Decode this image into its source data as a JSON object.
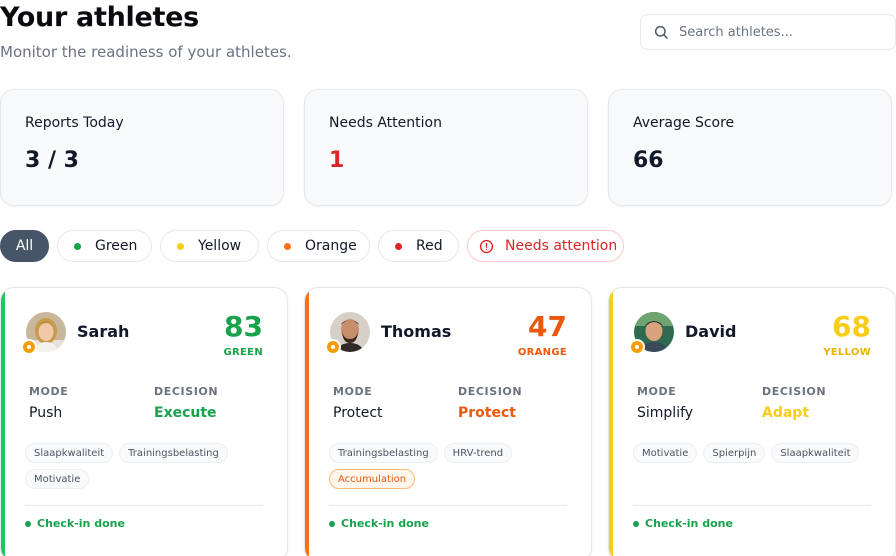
{
  "header": {
    "title": "Your athletes",
    "subtitle": "Monitor the readiness of your athletes."
  },
  "search": {
    "placeholder": "Search athletes...",
    "icon": "search-icon"
  },
  "stats": [
    {
      "label": "Reports Today",
      "value": "3 / 3"
    },
    {
      "label": "Needs Attention",
      "value": "1",
      "color": "#dc2626"
    },
    {
      "label": "Average Score",
      "value": "66"
    }
  ],
  "filters": [
    {
      "label": "All",
      "active": true
    },
    {
      "label": "Green",
      "color": "#16a34a"
    },
    {
      "label": "Yellow",
      "color": "#facc15"
    },
    {
      "label": "Orange",
      "color": "#f97316"
    },
    {
      "label": "Red",
      "color": "#dc2626"
    },
    {
      "label": "Needs attention",
      "icon": "alert-circle-icon",
      "color": "#dc2626"
    }
  ],
  "labels": {
    "mode": "MODE",
    "decision": "DECISION",
    "checkin": "Check-in done"
  },
  "athletes": [
    {
      "name": "Sarah",
      "score": "83",
      "status": "GREEN",
      "status_color": "#16a34a",
      "mode": "Push",
      "decision": "Execute",
      "tags": [
        "Slaapkwaliteit",
        "Trainingsbelasting",
        "Motivatie"
      ]
    },
    {
      "name": "Thomas",
      "score": "47",
      "status": "ORANGE",
      "status_color": "#ea580c",
      "mode": "Protect",
      "decision": "Protect",
      "tags": [
        "Trainingsbelasting",
        "HRV-trend"
      ],
      "warning_tag": "Accumulation"
    },
    {
      "name": "David",
      "score": "68",
      "status": "YELLOW",
      "status_color": "#facc15",
      "mode": "Simplify",
      "decision": "Adapt",
      "tags": [
        "Motivatie",
        "Spierpijn",
        "Slaapkwaliteit"
      ]
    }
  ]
}
